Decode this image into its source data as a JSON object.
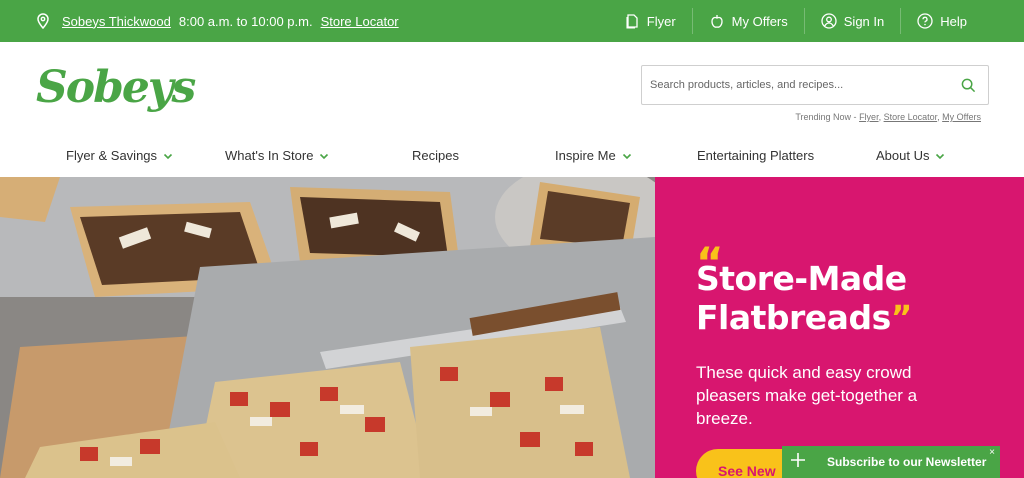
{
  "topbar": {
    "store_name": "Sobeys Thickwood",
    "hours": "8:00 a.m. to 10:00 p.m.",
    "store_locator": "Store Locator",
    "flyer": "Flyer",
    "my_offers": "My Offers",
    "sign_in": "Sign In",
    "help": "Help"
  },
  "header": {
    "logo_text": "Sobeys",
    "search_placeholder": "Search products, articles, and recipes...",
    "trending_prefix": "Trending Now - ",
    "trending_links": [
      "Flyer",
      "Store Locator",
      "My Offers"
    ]
  },
  "nav": {
    "items": [
      {
        "label": "Flyer & Savings"
      },
      {
        "label": "What's In Store"
      },
      {
        "label": "Recipes"
      },
      {
        "label": "Inspire Me"
      },
      {
        "label": "Entertaining Platters"
      },
      {
        "label": "About Us"
      }
    ]
  },
  "hero": {
    "quote_open": "“",
    "title_line1": "Store-Made",
    "title_line2": "Flatbreads",
    "quote_close": "”",
    "subtitle": "These quick and easy crowd pleasers make get-together a breeze.",
    "cta_label": "See New"
  },
  "newsletter": {
    "label": "Subscribe to our Newsletter",
    "close": "×"
  },
  "colors": {
    "brand_green": "#4aa546",
    "hero_magenta": "#d8166f",
    "accent_yellow": "#f9c21a"
  }
}
